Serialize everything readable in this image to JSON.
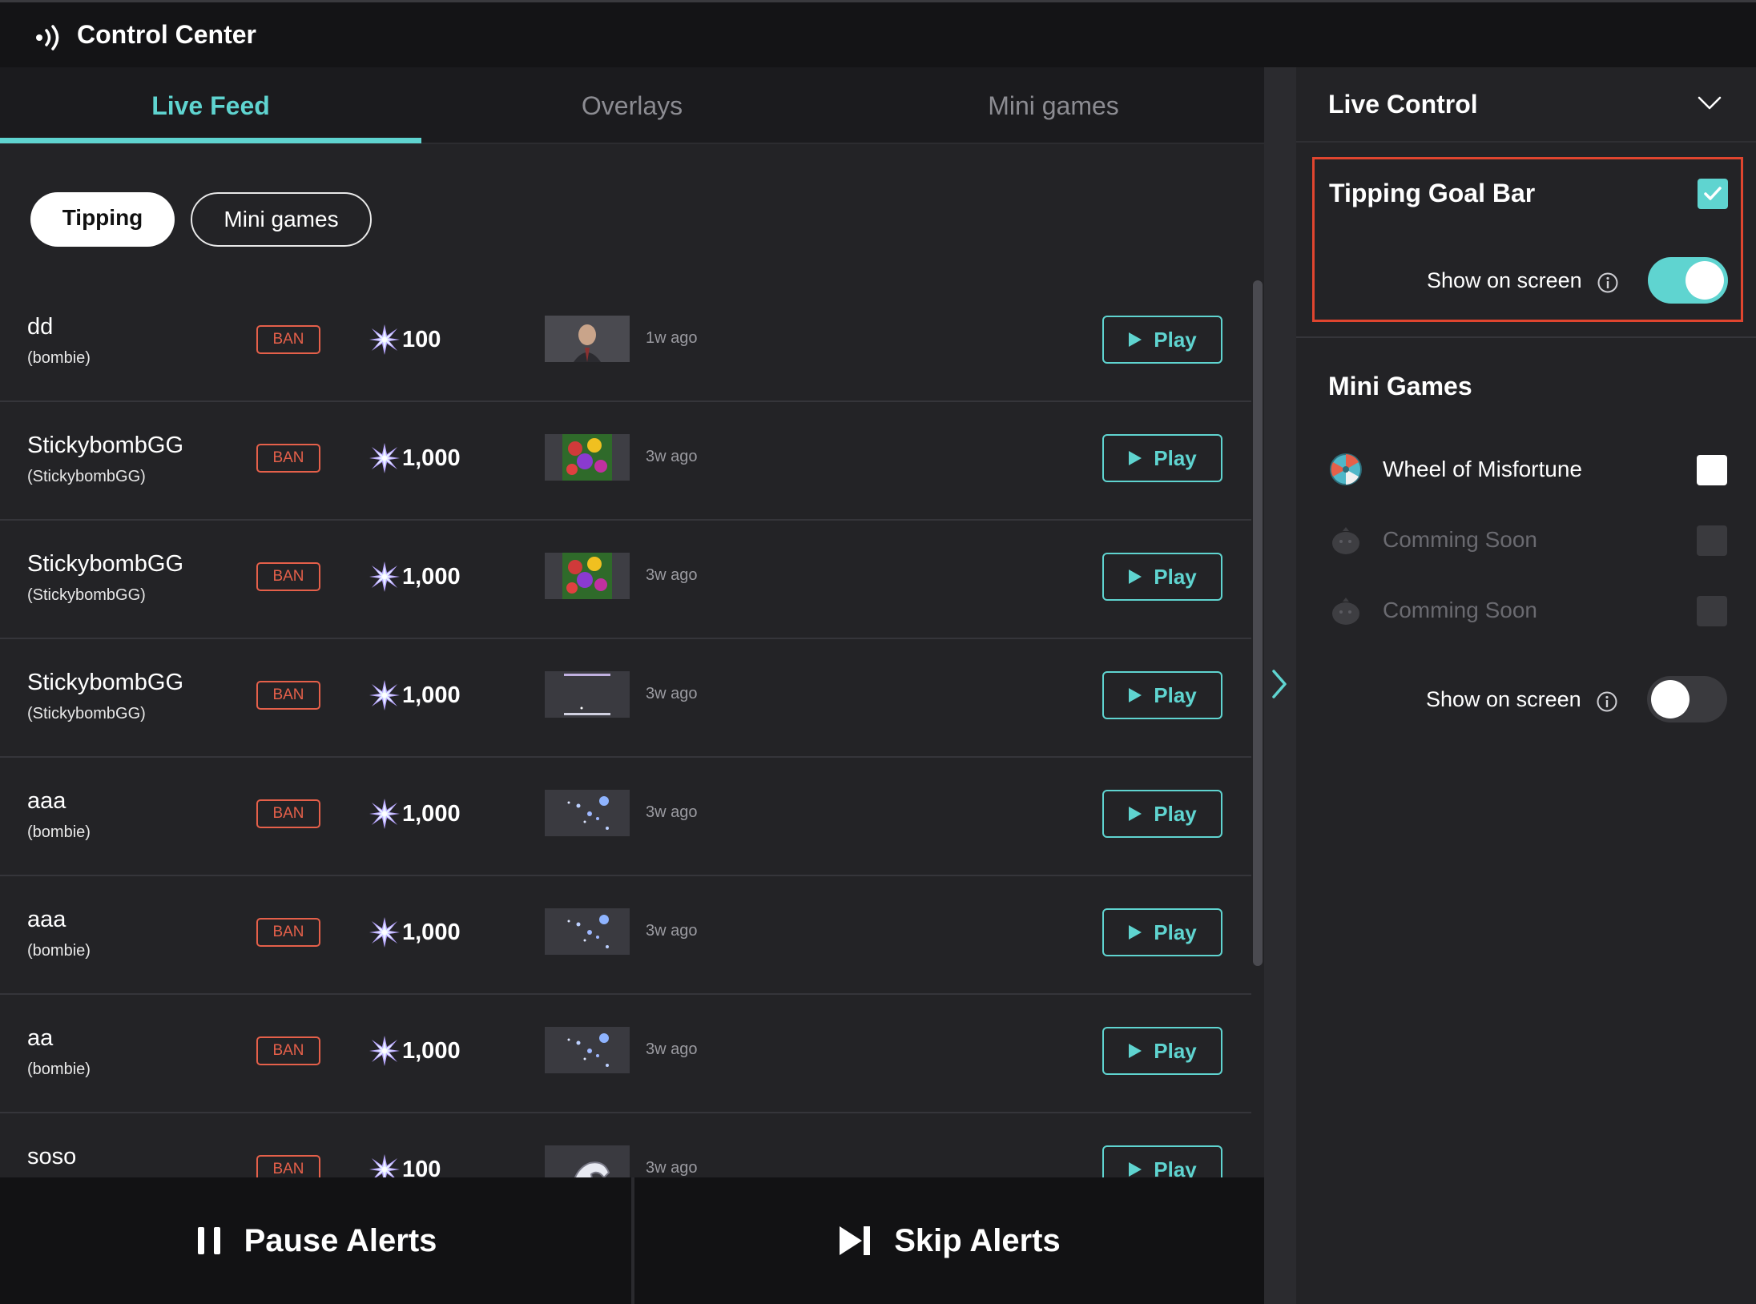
{
  "app": {
    "title": "Control Center",
    "icon": "broadcast-icon"
  },
  "tabs": [
    {
      "label": "Live Feed",
      "active": true
    },
    {
      "label": "Overlays",
      "active": false
    },
    {
      "label": "Mini games",
      "active": false
    }
  ],
  "filters": {
    "tipping": "Tipping",
    "mini_games": "Mini games",
    "active": "Tipping"
  },
  "feed": {
    "ban_label": "BAN",
    "play_label": "Play",
    "currency_icon": "star-burst-icon",
    "rows": [
      {
        "name": "dd",
        "handle": "(bombie)",
        "amount": "100",
        "time": "1w ago",
        "thumb": "man-portrait"
      },
      {
        "name": "StickybombGG",
        "handle": "(StickybombGG)",
        "amount": "1,000",
        "time": "3w ago",
        "thumb": "balloons"
      },
      {
        "name": "StickybombGG",
        "handle": "(StickybombGG)",
        "amount": "1,000",
        "time": "3w ago",
        "thumb": "balloons"
      },
      {
        "name": "StickybombGG",
        "handle": "(StickybombGG)",
        "amount": "1,000",
        "time": "3w ago",
        "thumb": "dark-frame"
      },
      {
        "name": "aaa",
        "handle": "(bombie)",
        "amount": "1,000",
        "time": "3w ago",
        "thumb": "bubbles"
      },
      {
        "name": "aaa",
        "handle": "(bombie)",
        "amount": "1,000",
        "time": "3w ago",
        "thumb": "bubbles"
      },
      {
        "name": "aa",
        "handle": "(bombie)",
        "amount": "1,000",
        "time": "3w ago",
        "thumb": "bubbles"
      },
      {
        "name": "soso",
        "handle": "",
        "amount": "100",
        "time": "3w ago",
        "thumb": "hand"
      }
    ]
  },
  "bottom": {
    "pause": "Pause Alerts",
    "skip": "Skip Alerts"
  },
  "live_control": {
    "title": "Live Control",
    "tipping_goal": {
      "title": "Tipping Goal Bar",
      "checked": true,
      "show_label": "Show on screen",
      "show_on": true
    },
    "mini_games": {
      "title": "Mini Games",
      "items": [
        {
          "label": "Wheel of Misfortune",
          "enabled": true,
          "checked": false,
          "icon": "wheel-icon"
        },
        {
          "label": "Comming Soon",
          "enabled": false,
          "checked": false,
          "icon": "blob-icon"
        },
        {
          "label": "Comming Soon",
          "enabled": false,
          "checked": false,
          "icon": "blob-icon"
        }
      ],
      "show_label": "Show on screen",
      "show_on": false
    }
  },
  "colors": {
    "accent": "#5fd4d0",
    "ban": "#e5604a",
    "highlight": "#e0452f",
    "background": "#232326"
  }
}
